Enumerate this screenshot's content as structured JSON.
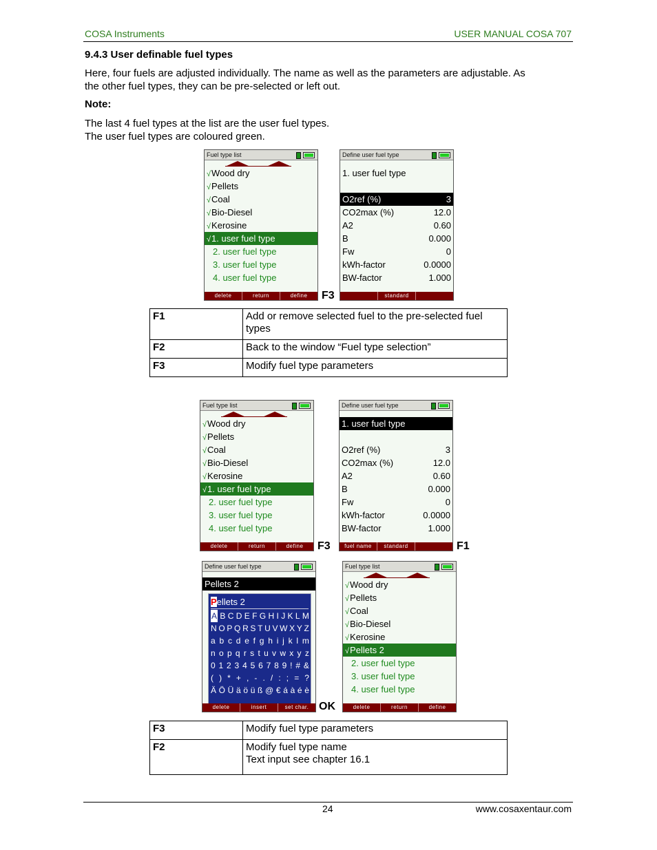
{
  "header": {
    "left": "COSA Instruments",
    "right": "USER MANUAL COSA 707"
  },
  "section": {
    "title": "9.4.3  User definable fuel types",
    "para1_line1": "Here, four fuels are adjusted individually. The name as well as the parameters are adjustable. As",
    "para1_line2": "the other fuel types, they can be pre-selected or left out.",
    "note_label": "Note:",
    "note_line1": "The last 4 fuel types at the list are the user fuel types.",
    "note_line2": "The user fuel types are coloured green."
  },
  "screens": {
    "list1": {
      "title": "Fuel type list",
      "items": [
        {
          "label": "Wood dry",
          "checked": "√"
        },
        {
          "label": "Pellets",
          "checked": "√"
        },
        {
          "label": "Coal",
          "checked": "√"
        },
        {
          "label": "Bio-Diesel",
          "checked": "√"
        },
        {
          "label": "Kerosine",
          "checked": "√"
        },
        {
          "label": "1. user fuel type",
          "checked": "√"
        },
        {
          "label": "2. user fuel type"
        },
        {
          "label": "3. user fuel type"
        },
        {
          "label": "4. user fuel type"
        }
      ],
      "fkeys": [
        "delete",
        "return",
        "define"
      ]
    },
    "define1": {
      "title": "Define user fuel type",
      "name": "1. user fuel type",
      "params": [
        {
          "label": "O2ref (%)",
          "value": "3"
        },
        {
          "label": "CO2max (%)",
          "value": "12.0"
        },
        {
          "label": "A2",
          "value": "0.60"
        },
        {
          "label": "B",
          "value": "0.000"
        },
        {
          "label": "Fw",
          "value": "0"
        },
        {
          "label": "kWh-factor",
          "value": "0.0000"
        },
        {
          "label": "BW-factor",
          "value": "1.000"
        }
      ],
      "fkeys": [
        "",
        "standard",
        ""
      ]
    },
    "define2": {
      "fkeys": [
        "fuel name",
        "standard",
        ""
      ]
    },
    "keyboard": {
      "title": "Define user fuel type",
      "name": "Pellets 2",
      "input_cursor": "P",
      "input_rest": "ellets 2",
      "rows": [
        [
          "A",
          "B",
          "C",
          "D",
          "E",
          "F",
          "G",
          "H",
          "I",
          "J",
          "K",
          "L",
          "M"
        ],
        [
          "N",
          "O",
          "P",
          "Q",
          "R",
          "S",
          "T",
          "U",
          "V",
          "W",
          "X",
          "Y",
          "Z"
        ],
        [
          "a",
          "b",
          "c",
          "d",
          "e",
          "f",
          "g",
          "h",
          "i",
          "j",
          "k",
          "l",
          "m"
        ],
        [
          "n",
          "o",
          "p",
          "q",
          "r",
          "s",
          "t",
          "u",
          "v",
          "w",
          "x",
          "y",
          "z"
        ],
        [
          "0",
          "1",
          "2",
          "3",
          "4",
          "5",
          "6",
          "7",
          "8",
          "9",
          "!",
          "#",
          "&"
        ],
        [
          "(",
          ")",
          "*",
          "+",
          ",",
          "-",
          ".",
          "/",
          ":",
          ";",
          "=",
          "?"
        ],
        [
          "Ä",
          "Ö",
          "Ü",
          "ä",
          "ö",
          "ü",
          "ß",
          "@",
          "€",
          "á",
          "à",
          "é",
          "è"
        ]
      ],
      "fkeys": [
        "delete",
        "insert",
        "set char."
      ]
    },
    "list2": {
      "title": "Fuel type list",
      "items": [
        {
          "label": "Wood dry",
          "checked": "√"
        },
        {
          "label": "Pellets",
          "checked": "√"
        },
        {
          "label": "Coal",
          "checked": "√"
        },
        {
          "label": "Bio-Diesel",
          "checked": "√"
        },
        {
          "label": "Kerosine",
          "checked": "√"
        },
        {
          "label": "Pellets 2",
          "checked": "√"
        },
        {
          "label": "2. user fuel type"
        },
        {
          "label": "3. user fuel type"
        },
        {
          "label": "4. user fuel type"
        }
      ],
      "fkeys": [
        "delete",
        "return",
        "define"
      ]
    }
  },
  "key_labels": {
    "f3": "F3",
    "f1": "F1",
    "ok": "OK"
  },
  "table1": [
    {
      "key": "F1",
      "desc": "Add or remove selected fuel to the pre-selected fuel types"
    },
    {
      "key": "F2",
      "desc": "Back to the window “Fuel type selection”"
    },
    {
      "key": "F3",
      "desc": "Modify fuel type parameters"
    }
  ],
  "table2": [
    {
      "key": "F3",
      "desc": "Modify fuel type parameters"
    },
    {
      "key": "F2",
      "desc_line1": "Modify fuel type name",
      "desc_line2": "Text input see chapter 16.1"
    }
  ],
  "footer": {
    "page": "24",
    "url": "www.cosaxentaur.com"
  }
}
